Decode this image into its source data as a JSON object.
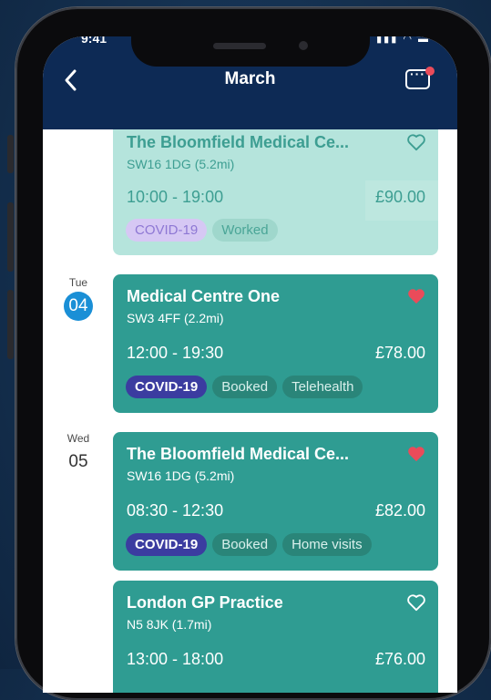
{
  "status_bar": {
    "time": "9:41"
  },
  "header": {
    "title": "March"
  },
  "days": [
    {
      "dow": "Tue",
      "num": "04",
      "active": true
    },
    {
      "dow": "Wed",
      "num": "05",
      "active": false
    }
  ],
  "shifts": [
    {
      "name": "The Bloomfield Medical Ce...",
      "postcode": "SW16 1DG (5.2mi)",
      "time": "10:00 - 19:00",
      "price": "£90.00",
      "tags": [
        "COVID-19",
        "Worked"
      ],
      "favourite": false
    },
    {
      "name": "Medical Centre One",
      "postcode": "SW3 4FF (2.2mi)",
      "time": "12:00 - 19:30",
      "price": "£78.00",
      "tags": [
        "COVID-19",
        "Booked",
        "Telehealth"
      ],
      "favourite": true
    },
    {
      "name": "The Bloomfield Medical Ce...",
      "postcode": "SW16 1DG (5.2mi)",
      "time": "08:30 - 12:30",
      "price": "£82.00",
      "tags": [
        "COVID-19",
        "Booked",
        "Home visits"
      ],
      "favourite": true
    },
    {
      "name": "London GP Practice",
      "postcode": "N5 8JK (1.7mi)",
      "time": "13:00 - 18:00",
      "price": "£76.00",
      "tags": [],
      "favourite": false
    }
  ],
  "colors": {
    "header": "#0d2a55",
    "card": "#2f9c92",
    "covid_tag": "#3b3ca0",
    "heart_active": "#ea4b5a",
    "today_badge": "#1a8fd6"
  }
}
